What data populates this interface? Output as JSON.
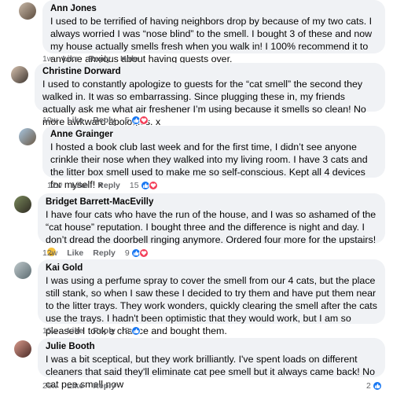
{
  "comments": [
    {
      "author": "Ann Jones",
      "text": "I used to be terrified of having neighbors drop by because of my two cats. I always worried I was “nose blind” to the smell. I bought 3 of these and now my house actually smells fresh when you walk in! I 100% recommend it to anyone anxious about having guests over.",
      "time": "1w",
      "like": "Like",
      "reply": "Reply",
      "hide": "Hide",
      "reactions": ""
    },
    {
      "author": "Christine Dorward",
      "text": "I used to constantly apologize to guests for the “cat smell” the second they walked in. It was so embarrassing. Since plugging these in, my friends actually ask me what air freshener I’m using because it smells so clean! No more awkward apologies. x",
      "time": "10w",
      "like": "Like",
      "reply": "Reply",
      "reactions": "5"
    },
    {
      "author": "Anne Grainger",
      "text": "I hosted a book club last week and for the first time, I didn’t see anyone crinkle their nose when they walked into my living room. I have 3 cats and the litter box smell used to make me so self-conscious. Kept all 4 devices for myself! x",
      "time": "12w",
      "like": "Like",
      "reply": "Reply",
      "reactions": "15"
    },
    {
      "author": "Bridget Barrett-MacEvilly",
      "text": "I have four cats who have the run of the house, and I was so ashamed of the “cat house” reputation. I bought three and the difference is night and day. I don’t dread the doorbell ringing anymore. Ordered four more for the upstairs!",
      "time": "12w",
      "like": "Like",
      "reply": "Reply",
      "reactions": "9"
    },
    {
      "author": "Kai Gold",
      "text": "I was using a perfume spray to cover the smell from our 4 cats, but the place still stank, so when I saw these I decided to try them and have put them near to the litter trays. They work wonders, quickly clearing the smell after the cats use the trays. I hadn't been optimistic that they would work, but I am so pleased I took a chance and bought them.",
      "time": "15w",
      "like": "Like",
      "reply": "Reply",
      "reactions": "8"
    },
    {
      "author": "Julie Booth",
      "text": "I was a bit sceptical, but they work brilliantly. I've spent loads on different cleaners that said they'll eliminate cat pee smell but it always came back! No cat pee smell now",
      "time": "26w",
      "like": "Like",
      "reply": "Reply",
      "reactions": "2"
    }
  ],
  "colors": {
    "bubble": "#f0f2f5",
    "meta_text": "#65676b",
    "like_reaction": "#1877f2",
    "love_reaction": "#f33e58"
  }
}
